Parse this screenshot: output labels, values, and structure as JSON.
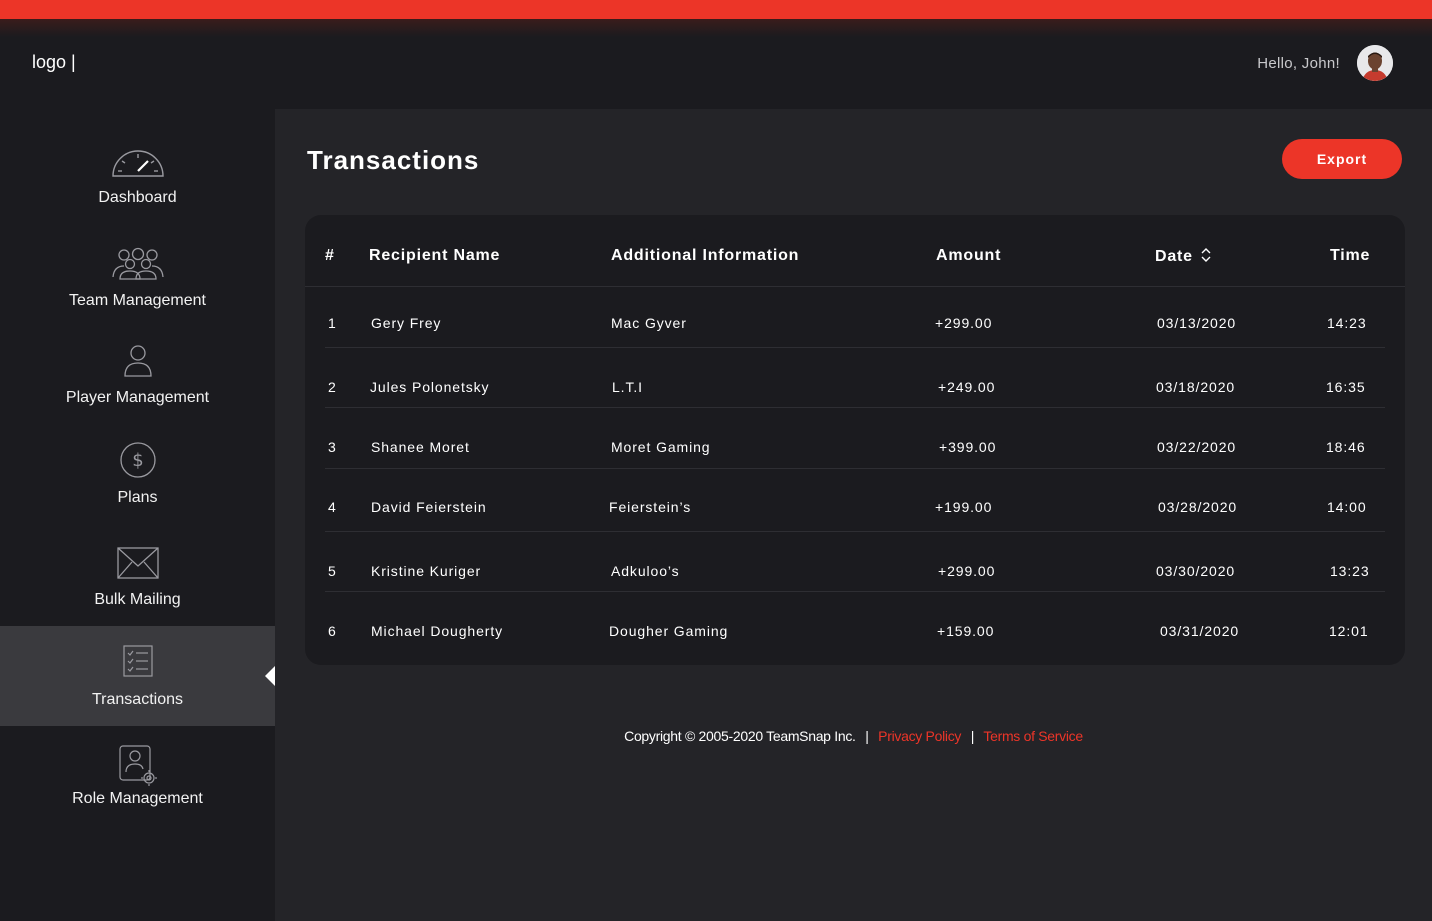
{
  "header": {
    "logo": "logo |",
    "greeting": "Hello, John!"
  },
  "sidebar": {
    "items": [
      {
        "label": "Dashboard",
        "icon": "speedometer-icon"
      },
      {
        "label": "Team Management",
        "icon": "team-icon"
      },
      {
        "label": "Player Management",
        "icon": "user-icon"
      },
      {
        "label": "Plans",
        "icon": "dollar-icon"
      },
      {
        "label": "Bulk Mailing",
        "icon": "envelope-icon"
      },
      {
        "label": "Transactions",
        "icon": "checklist-icon",
        "active": true
      },
      {
        "label": "Role Management",
        "icon": "user-settings-icon"
      }
    ]
  },
  "main": {
    "title": "Transactions",
    "export_label": "Export",
    "table": {
      "headers": {
        "num": "#",
        "recipient": "Recipient Name",
        "info": "Additional Information",
        "amount": "Amount",
        "date": "Date",
        "time": "Time"
      },
      "rows": [
        {
          "num": "1",
          "recipient": "Gery Frey",
          "info": "Mac Gyver",
          "amount": "+299.00",
          "date": "03/13/2020",
          "time": "14:23"
        },
        {
          "num": "2",
          "recipient": "Jules Polonetsky",
          "info": "L.T.I",
          "amount": "+249.00",
          "date": "03/18/2020",
          "time": "16:35"
        },
        {
          "num": "3",
          "recipient": "Shanee Moret",
          "info": "Moret Gaming",
          "amount": "+399.00",
          "date": "03/22/2020",
          "time": "18:46"
        },
        {
          "num": "4",
          "recipient": "David Feierstein",
          "info": "Feierstein’s",
          "amount": "+199.00",
          "date": "03/28/2020",
          "time": "14:00"
        },
        {
          "num": "5",
          "recipient": "Kristine Kuriger",
          "info": "Adkuloo’s",
          "amount": "+299.00",
          "date": "03/30/2020",
          "time": "13:23"
        },
        {
          "num": "6",
          "recipient": "Michael Dougherty",
          "info": "Dougher Gaming",
          "amount": "+159.00",
          "date": "03/31/2020",
          "time": "12:01"
        }
      ]
    }
  },
  "footer": {
    "copyright": "Copyright © 2005-2020 TeamSnap Inc.",
    "privacy": "Privacy Policy",
    "terms": "Terms of Service"
  },
  "colors": {
    "accent": "#ec3528",
    "background": "#1b1b1f",
    "panel": "#242428"
  }
}
